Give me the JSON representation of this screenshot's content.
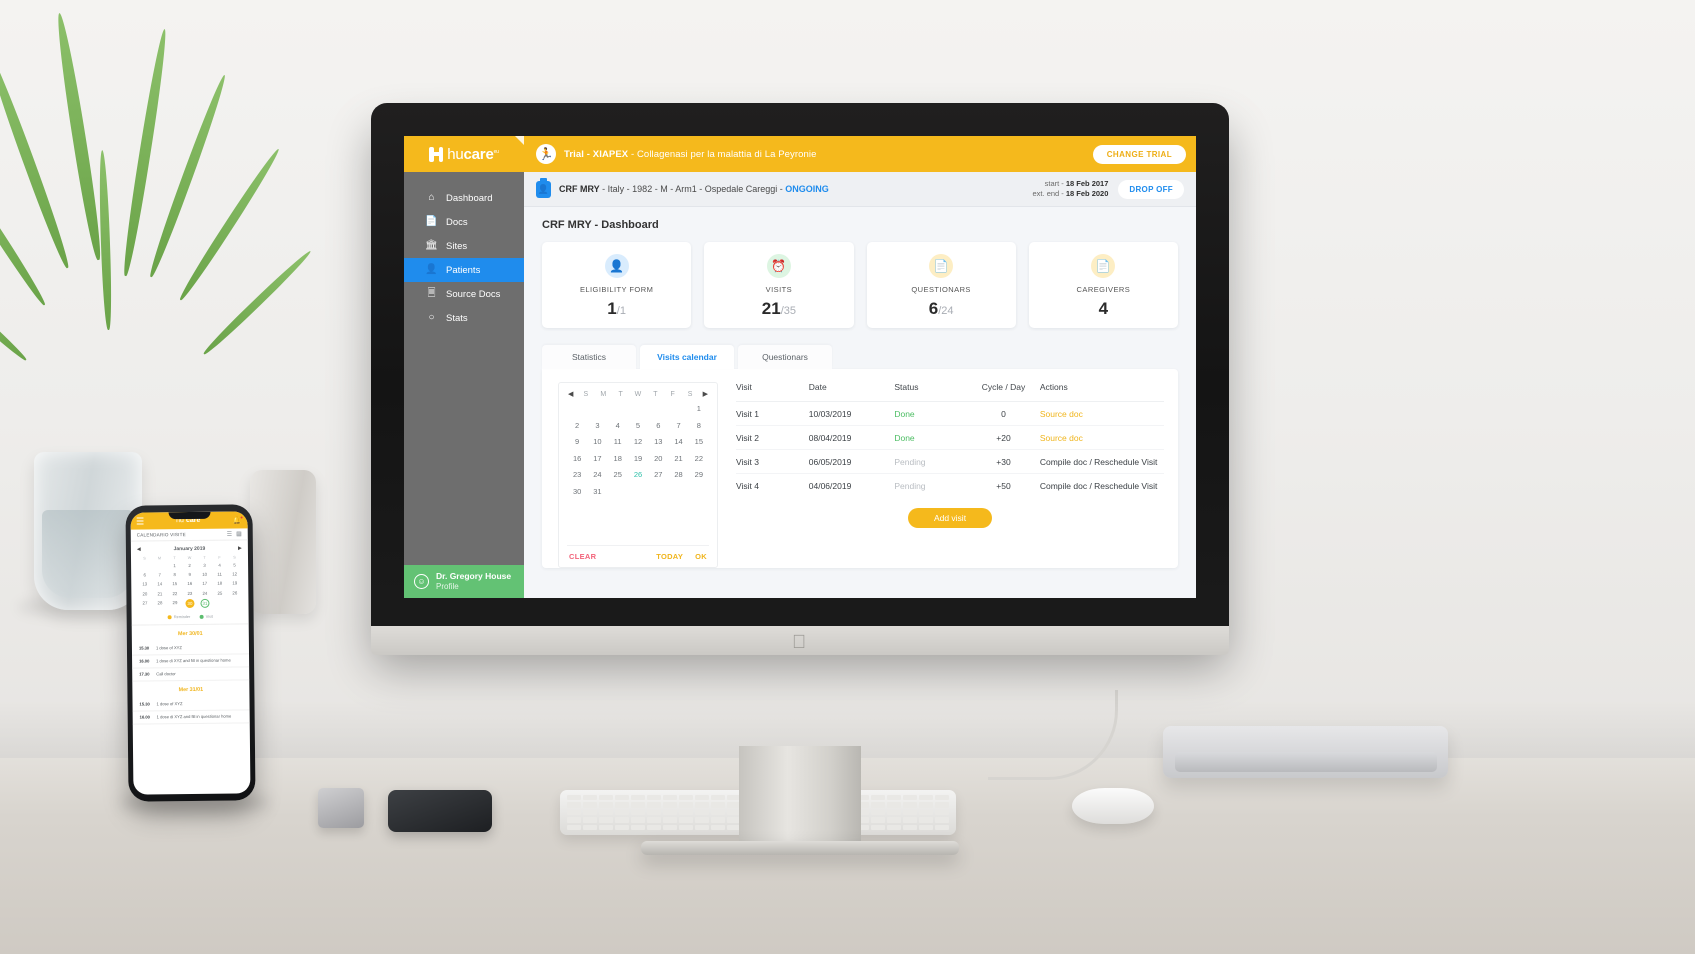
{
  "app": {
    "brand": {
      "name_light": "hu",
      "name_bold": "care",
      "tm": "eu"
    },
    "trial": {
      "icon": "runner-icon",
      "label_bold": "Trial - XIAPEX",
      "label_rest": " - Collagenasi per la malattia di La Peyronie",
      "change_button": "CHANGE TRIAL"
    }
  },
  "sidebar": {
    "items": [
      {
        "label": "Dashboard",
        "icon": "home-icon",
        "active": false
      },
      {
        "label": "Docs",
        "icon": "document-icon",
        "active": false
      },
      {
        "label": "Sites",
        "icon": "bank-icon",
        "active": false
      },
      {
        "label": "Patients",
        "icon": "patient-id-icon",
        "active": true
      },
      {
        "label": "Source Docs",
        "icon": "source-docs-icon",
        "active": false
      },
      {
        "label": "Stats",
        "icon": "stats-icon",
        "active": false
      }
    ],
    "profile": {
      "name": "Dr. Gregory House",
      "sub": "Profile",
      "icon": "user-circle-icon"
    }
  },
  "patient_bar": {
    "icon": "patient-badge-icon",
    "code": "CRF MRY",
    "details": " - Italy - 1982 - M - Arm1 - Ospedale Careggi - ",
    "status": "ONGOING",
    "start_label": "start - ",
    "start_value": "18 Feb 2017",
    "end_label": "ext. end - ",
    "end_value": "18 Feb 2020",
    "drop_off": "DROP OFF"
  },
  "main": {
    "page_title": "CRF MRY - Dashboard",
    "cards": [
      {
        "label": "ELIGIBILITY FORM",
        "value": "1",
        "total": "/1",
        "icon": "eligibility-icon",
        "color": "blue"
      },
      {
        "label": "VISITS",
        "value": "21",
        "total": "/35",
        "icon": "visits-icon",
        "color": "green"
      },
      {
        "label": "QUESTIONARS",
        "value": "6",
        "total": "/24",
        "icon": "questionars-icon",
        "color": "yellow"
      },
      {
        "label": "CAREGIVERS",
        "value": "4",
        "total": "",
        "icon": "caregivers-icon",
        "color": "yellow"
      }
    ],
    "tabs": [
      {
        "label": "Statistics",
        "active": false
      },
      {
        "label": "Visits calendar",
        "active": true
      },
      {
        "label": "Questionars",
        "active": false
      }
    ],
    "calendar": {
      "prev_icon": "caret-left-icon",
      "next_icon": "caret-right-icon",
      "dow": [
        "S",
        "M",
        "T",
        "W",
        "T",
        "F",
        "S"
      ],
      "lead_blanks": 6,
      "days": [
        1,
        2,
        3,
        4,
        5,
        6,
        7,
        8,
        9,
        10,
        11,
        12,
        13,
        14,
        15,
        16,
        17,
        18,
        19,
        20,
        21,
        22,
        23,
        24,
        25,
        26,
        27,
        28,
        29,
        30,
        31
      ],
      "selected_day": 26,
      "clear": "CLEAR",
      "today": "TODAY",
      "ok": "OK"
    },
    "table": {
      "columns": [
        "Visit",
        "Date",
        "Status",
        "Cycle / Day",
        "Actions"
      ],
      "rows": [
        {
          "visit": "Visit 1",
          "date": "10/03/2019",
          "status": "Done",
          "cycle": "0",
          "action": "Source doc",
          "status_kind": "done",
          "action_kind": "source"
        },
        {
          "visit": "Visit 2",
          "date": "08/04/2019",
          "status": "Done",
          "cycle": "+20",
          "action": "Source doc",
          "status_kind": "done",
          "action_kind": "source"
        },
        {
          "visit": "Visit 3",
          "date": "06/05/2019",
          "status": "Pending",
          "cycle": "+30",
          "action": "Compile doc / Reschedule Visit",
          "status_kind": "pending",
          "action_kind": "plain"
        },
        {
          "visit": "Visit 4",
          "date": "04/06/2019",
          "status": "Pending",
          "cycle": "+50",
          "action": "Compile doc / Reschedule Visit",
          "status_kind": "pending",
          "action_kind": "plain"
        }
      ],
      "add_visit": "Add visit"
    }
  },
  "phone": {
    "brand_light": "hu",
    "brand_bold": "care",
    "subheader": "CALENDARIO VISITE",
    "month": "January 2019",
    "dow": [
      "S",
      "M",
      "T",
      "W",
      "T",
      "F",
      "S"
    ],
    "lead_blanks": 2,
    "days": [
      1,
      2,
      3,
      4,
      5,
      6,
      7,
      8,
      9,
      10,
      11,
      12,
      13,
      14,
      15,
      16,
      17,
      18,
      19,
      20,
      21,
      22,
      23,
      24,
      25,
      26,
      27,
      28,
      29,
      30,
      31
    ],
    "selected_day": 30,
    "ring_day": 31,
    "legend": [
      {
        "label": "Reminder",
        "color": "#f5b91c"
      },
      {
        "label": "Visit",
        "color": "#5bbd6e"
      }
    ],
    "sections": [
      {
        "title": "Mer 30/01",
        "rows": [
          {
            "time": "15.30",
            "text": "1 dose of XYZ"
          },
          {
            "time": "16.00",
            "text": "1 dose di XYZ and fill in questionar home"
          },
          {
            "time": "17.30",
            "text": "Call doctor"
          }
        ]
      },
      {
        "title": "Mer 31/01",
        "rows": [
          {
            "time": "15.30",
            "text": "1 dose of XYZ"
          },
          {
            "time": "16.00",
            "text": "1 dose di XYZ and fill in questionar home"
          }
        ]
      }
    ]
  },
  "colors": {
    "brand_yellow": "#f5b91c",
    "accent_blue": "#1f8ced",
    "green": "#4cbd63",
    "sidebar_gray": "#6e6e6e",
    "profile_green": "#63c274",
    "teal_selected": "#2bbfa8",
    "pink_clear": "#f2637a"
  }
}
